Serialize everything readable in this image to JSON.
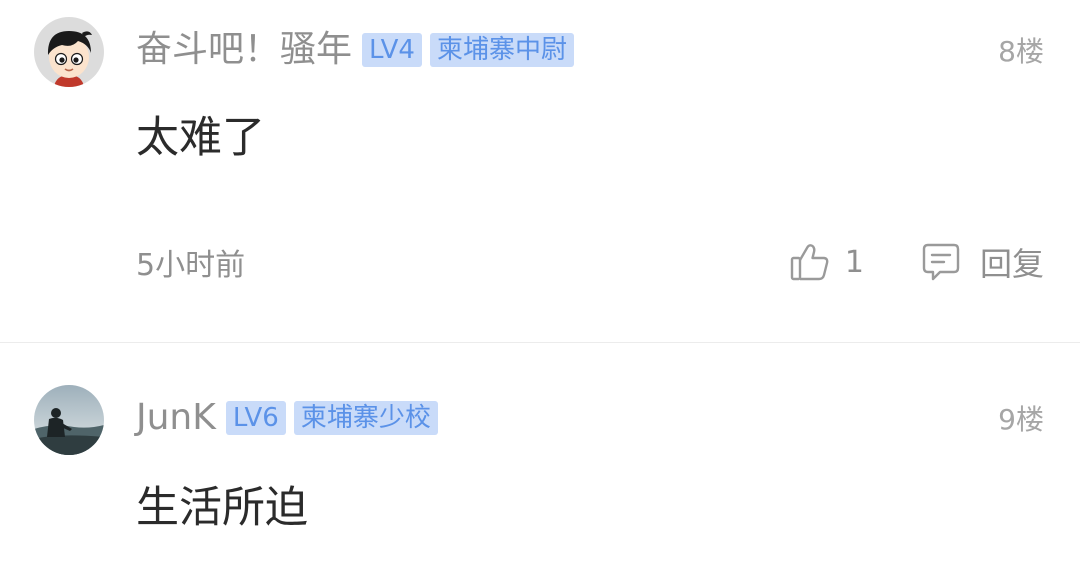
{
  "comments": [
    {
      "username": "奋斗吧！骚年",
      "level": "LV4",
      "title": "柬埔寨中尉",
      "floor": "8楼",
      "content": "太难了",
      "time": "5小时前",
      "likes": "1",
      "reply_label": "回复",
      "avatar_icon": "cartoon-face-avatar"
    },
    {
      "username": "JunK",
      "level": "LV6",
      "title": "柬埔寨少校",
      "floor": "9楼",
      "content": "生活所迫",
      "avatar_icon": "photo-avatar"
    }
  ],
  "colors": {
    "badge_bg": "#c9dbf9",
    "badge_text": "#5b92e8",
    "meta_text": "#8f8f8f",
    "content_text": "#2b2b2b"
  }
}
